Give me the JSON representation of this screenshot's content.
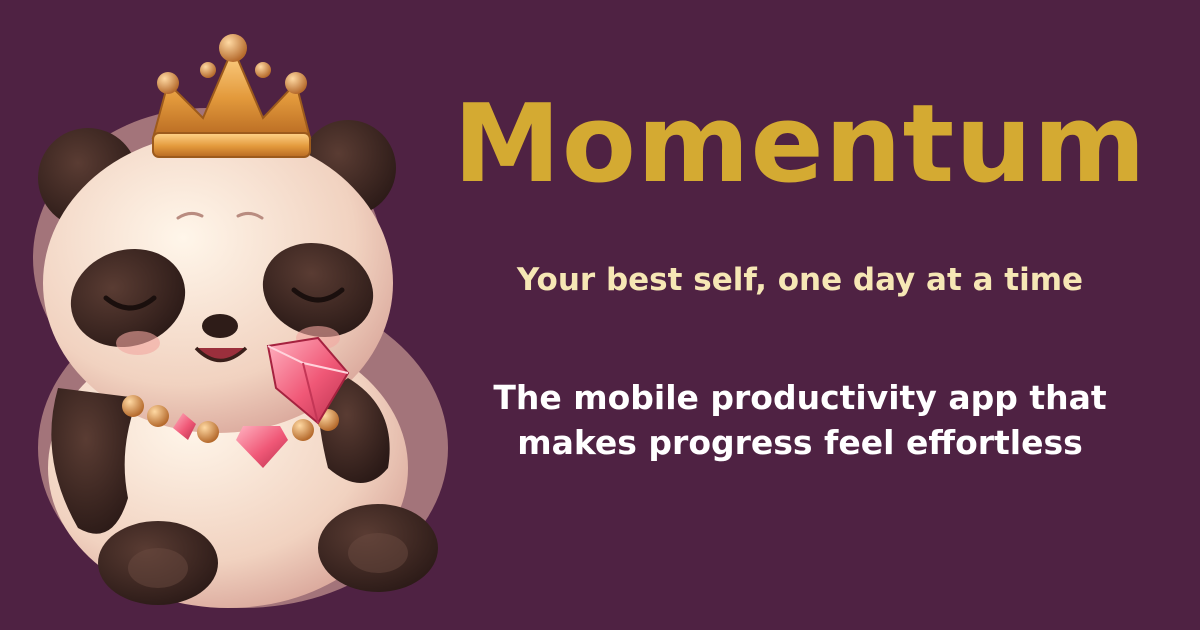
{
  "brand": {
    "title": "Momentum",
    "tagline": "Your best self, one day at a time",
    "description_lines": [
      "The mobile productivity app that",
      "makes progress feel effortless"
    ]
  },
  "mascot": {
    "icon": "panda-king-mascot-icon",
    "accessories": [
      "crown-icon",
      "ruby-gem-icon",
      "bead-necklace-icon"
    ]
  },
  "colors": {
    "background": "#4f2243",
    "title": "#d4aa32",
    "tagline": "#f6e7b5",
    "description": "#ffffff"
  }
}
